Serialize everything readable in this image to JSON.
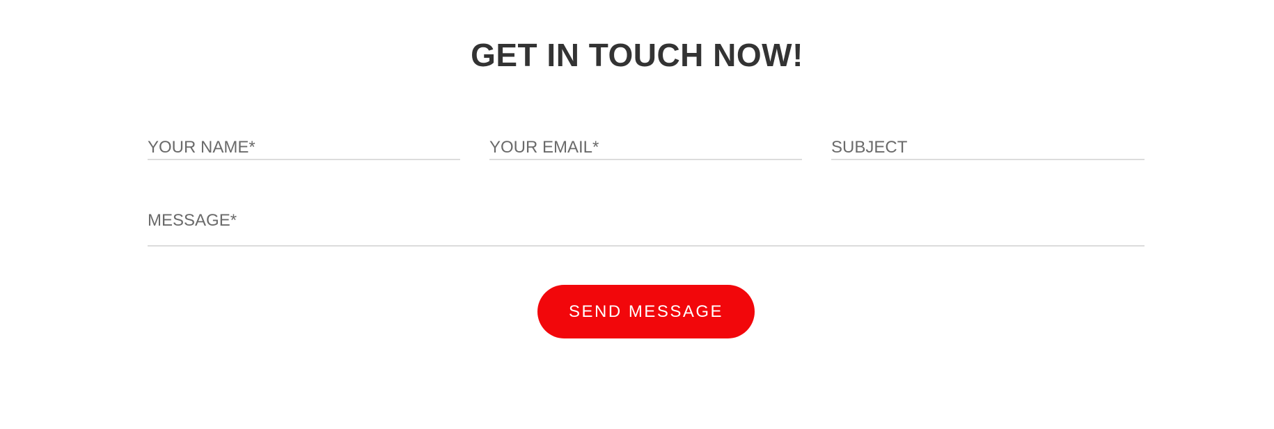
{
  "section": {
    "title": "GET IN TOUCH NOW!"
  },
  "form": {
    "name": {
      "placeholder": "YOUR NAME*",
      "value": ""
    },
    "email": {
      "placeholder": "YOUR EMAIL*",
      "value": ""
    },
    "subject": {
      "placeholder": "SUBJECT",
      "value": ""
    },
    "message": {
      "placeholder": "MESSAGE*",
      "value": ""
    },
    "submit_label": "SEND MESSAGE"
  },
  "colors": {
    "accent": "#f2070b",
    "title": "#333333",
    "placeholder": "#6a6a6a",
    "underline": "#dcdcdc"
  }
}
